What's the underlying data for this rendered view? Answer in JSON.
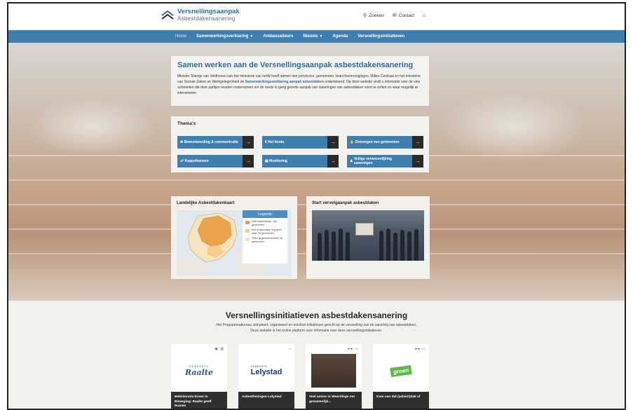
{
  "header": {
    "logo_line1": "Versnellingsaanpak",
    "logo_line2": "Asbestdakensanering",
    "search_label": "Zoeken",
    "contact_label": "Contact",
    "icons": [
      "search-icon",
      "envelope-icon",
      "home-icon"
    ]
  },
  "nav": {
    "items": [
      {
        "label": "Home",
        "dropdown": false,
        "active": true
      },
      {
        "label": "Samenwerkingsverklaring",
        "dropdown": true,
        "active": false
      },
      {
        "label": "Ambassadeurs",
        "dropdown": false,
        "active": false
      },
      {
        "label": "Nieuws",
        "dropdown": true,
        "active": false
      },
      {
        "label": "Agenda",
        "dropdown": false,
        "active": false
      },
      {
        "label": "Versnellingsinitiatieven",
        "dropdown": false,
        "active": false
      }
    ]
  },
  "intro": {
    "title": "Samen werken aan de Versnellingsaanpak asbestdakensanering",
    "body_part1": "Minister Stientje van Veldhoven van het ministerie van IenW heeft samen met provincies, gemeenten, brancheverenigingen, Milieu Centraal en het ministerie van Sociale Zaken en Werkgelegenheid de ",
    "body_link": "Samenwerkingsverklaring aanpak asbestdaken",
    "body_part2": " ondertekend. Op deze website vindt u informatie over de vele activiteiten die door partijen worden ondernomen om de reeds in gang gezette aanpak van saneringen van asbestdaken voort te zetten en waar mogelijk te intensiveren."
  },
  "themes": {
    "title": "Thema's",
    "items": [
      {
        "label": "Bewustwording & communicatie",
        "icon": "megaphone-icon"
      },
      {
        "label": "Het fonds",
        "icon": "euro-icon"
      },
      {
        "label": "Ontzorgen van gemeenten",
        "icon": "handshake-icon"
      },
      {
        "label": "Koppelkansen",
        "icon": "link-icon"
      },
      {
        "label": "Monitoring",
        "icon": "chart-icon"
      },
      {
        "label": "Veilige verwezenlijking saneringen",
        "icon": "worker-icon"
      }
    ]
  },
  "map_card": {
    "title": "Landelijke Asbestdakenkaart",
    "legend_title": "Legenda",
    "legend": [
      {
        "text": "Data beschikbaar: 180 gemeenten",
        "color": "#e9a34a"
      },
      {
        "text": "Wel in aanvraag, nog geen data: 76 gemeenten",
        "color": "#f4cf8a"
      },
      {
        "text": "Geen gegevens bekend: 96 gemeenten",
        "color": "#f7e3bd"
      }
    ]
  },
  "start_card": {
    "title": "Start vervolgaanpak asbestdaken"
  },
  "initiatives": {
    "title": "Versnellingsinitiatieven asbestdakensanering",
    "sub_line1": "Het Programmabureau stimuleert, organiseert en monitort initiatieven gericht op de versnelling van de sanering van asbestdaken.",
    "sub_line2": "Deze website is het online platform voor informatie over deze versnellingsinitiatieven.",
    "cards": [
      {
        "logo_text": "Raalte",
        "logo_pretext": "GEMEENTE",
        "caption": "Beleidsnota Erven in Beweging: Raalte geeft Ruimte",
        "icons": "◉ ▥"
      },
      {
        "logo_text": "Lelystad",
        "logo_pretext": "GEMEENTE",
        "caption": "Asbestleningen Lelystad",
        "icons": "⌂"
      },
      {
        "logo_text": "",
        "logo_pretext": "",
        "caption": "Veel animo in Weerdinge om gezamenlijk...",
        "icons": "●● ▭"
      },
      {
        "logo_text": "groen",
        "logo_pretext": "",
        "caption": "Kom van dat (asbest)dak af",
        "icons": "●● ▭"
      }
    ]
  }
}
